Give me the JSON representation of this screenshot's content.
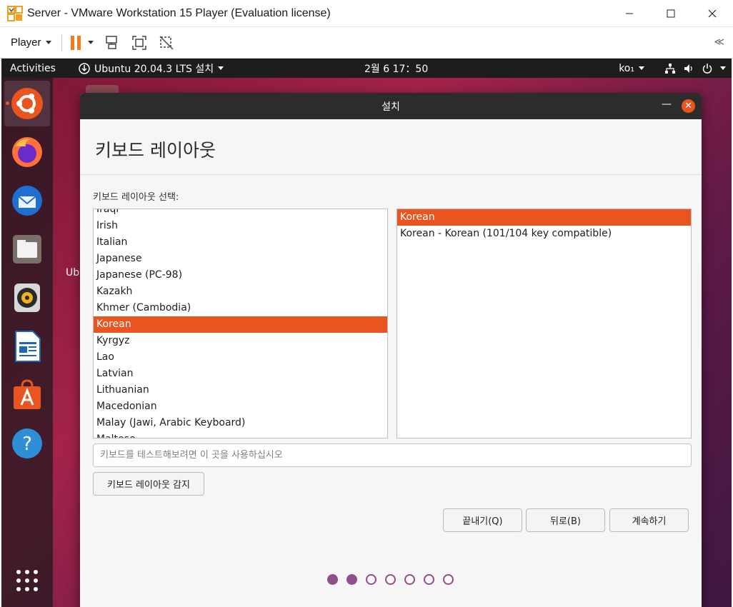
{
  "window": {
    "title": "Server - VMware Workstation 15 Player (Evaluation license)",
    "minimize": "—",
    "maximize": "☐",
    "close": "✕"
  },
  "toolbar": {
    "player_label": "Player",
    "collapse": "≪",
    "icons": [
      "pause-icon",
      "send-ctrl-alt-del-icon",
      "full-screen-icon",
      "unity-icon"
    ]
  },
  "ubuntu_topbar": {
    "activities": "Activities",
    "app_menu": "Ubuntu 20.04.3 LTS 설치",
    "clock": "2월 6  17：50",
    "input_method": "ko₁"
  },
  "dock": {
    "items": [
      "ubuntu-installer-icon",
      "firefox-icon",
      "thunderbird-icon",
      "files-icon",
      "rhythmbox-icon",
      "libreoffice-writer-icon",
      "ubuntu-software-icon",
      "help-icon",
      "show-applications-icon"
    ]
  },
  "desktop": {
    "label": "Ubı"
  },
  "dialog": {
    "title": "설치",
    "heading": "키보드 레이아웃",
    "section_label": "키보드 레이아웃 선택:",
    "layouts": [
      {
        "label": "Iraqi",
        "selected": false
      },
      {
        "label": "Irish",
        "selected": false
      },
      {
        "label": "Italian",
        "selected": false
      },
      {
        "label": "Japanese",
        "selected": false
      },
      {
        "label": "Japanese (PC-98)",
        "selected": false
      },
      {
        "label": "Kazakh",
        "selected": false
      },
      {
        "label": "Khmer (Cambodia)",
        "selected": false
      },
      {
        "label": "Korean",
        "selected": true
      },
      {
        "label": "Kyrgyz",
        "selected": false
      },
      {
        "label": "Lao",
        "selected": false
      },
      {
        "label": "Latvian",
        "selected": false
      },
      {
        "label": "Lithuanian",
        "selected": false
      },
      {
        "label": "Macedonian",
        "selected": false
      },
      {
        "label": "Malay (Jawi, Arabic Keyboard)",
        "selected": false
      },
      {
        "label": "Maltese",
        "selected": false
      }
    ],
    "variants": [
      {
        "label": "Korean",
        "selected": true
      },
      {
        "label": "Korean - Korean (101/104 key compatible)",
        "selected": false
      }
    ],
    "test_placeholder": "키보드를 테스트해보려면 이 곳을 사용하십시오",
    "test_value": "",
    "detect_button": "키보드 레이아웃 감지",
    "quit_button": "끝내기(Q)",
    "back_button": "뒤로(B)",
    "continue_button": "계속하기",
    "progress": {
      "total_steps": 7,
      "completed_steps": 2
    },
    "accent_color": "#e95420",
    "progress_color": "#8f4f8b"
  }
}
